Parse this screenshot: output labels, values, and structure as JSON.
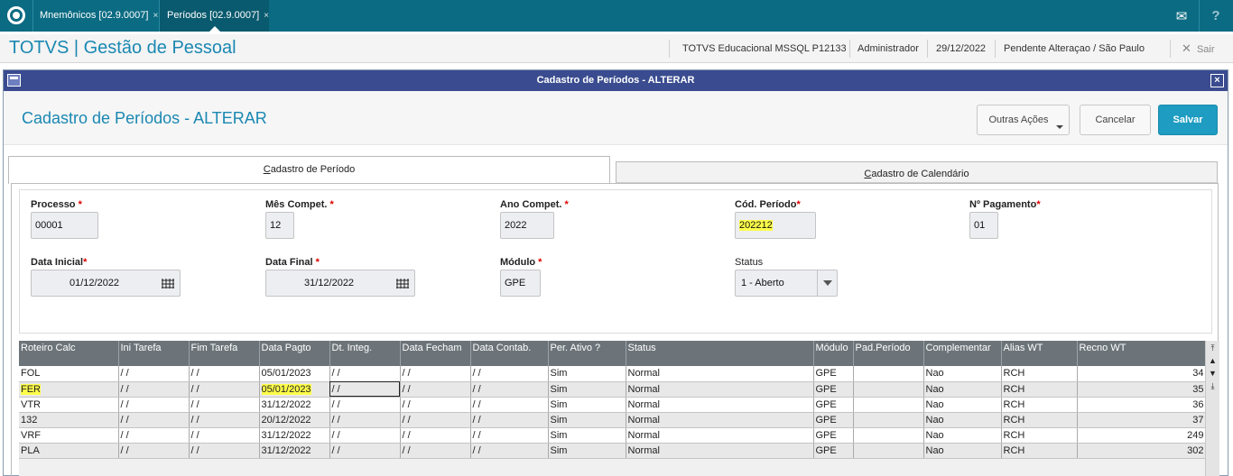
{
  "topbar": {
    "tabs": [
      {
        "label": "Mnemônicos [02.9.0007]"
      },
      {
        "label": "Períodos [02.9.0007]"
      }
    ],
    "close_glyph": "×",
    "mail_icon": "✉",
    "help_icon": "?"
  },
  "header": {
    "title": "TOTVS | Gestão de Pessoal",
    "environment": "TOTVS Educacional MSSQL P12133",
    "user": "Administrador",
    "date": "29/12/2022",
    "branch": "Pendente Alteraçao / São Paulo",
    "exit_label": "Sair",
    "exit_icon": "✕"
  },
  "dialog": {
    "window_title": "Cadastro de Períodos - ALTERAR",
    "close_glyph": "×",
    "form_title": "Cadastro de Períodos - ALTERAR",
    "buttons": {
      "other_actions": "Outras Ações",
      "cancel": "Cancelar",
      "save": "Salvar"
    },
    "tabs": [
      {
        "first": "C",
        "rest": "adastro de Período"
      },
      {
        "first": "C",
        "rest": "adastro de Calendário"
      }
    ]
  },
  "fields": {
    "processo": {
      "label": "Processo",
      "value": "00001"
    },
    "mes_compet": {
      "label": "Mês Compet.",
      "value": "12"
    },
    "ano_compet": {
      "label": "Ano Compet.",
      "value": "2022"
    },
    "cod_periodo": {
      "label": "Cód. Período",
      "value": "202212"
    },
    "n_pagamento": {
      "label": "Nº Pagamento",
      "value": "01"
    },
    "data_inicial": {
      "label": "Data Inicial",
      "value": "01/12/2022"
    },
    "data_final": {
      "label": "Data Final",
      "value": "31/12/2022"
    },
    "modulo": {
      "label": "Módulo",
      "value": "GPE"
    },
    "status": {
      "label": "Status",
      "value": "1 - Aberto"
    },
    "required_mark": "*"
  },
  "grid": {
    "columns": [
      "Roteiro Calc",
      "Ini Tarefa",
      "Fim Tarefa",
      "Data Pagto",
      "Dt. Integ.",
      "Data Fecham",
      "Data Contab.",
      "Per. Ativo ?",
      "Status",
      "Módulo",
      "Pad.Período",
      "Complementar",
      "Alias WT",
      "Recno WT"
    ],
    "rows": [
      [
        "FOL",
        " / /",
        " / /",
        "05/01/2023",
        " / /",
        " / /",
        " / /",
        "Sim",
        "Normal",
        "GPE",
        "",
        "Nao",
        "RCH",
        "34"
      ],
      [
        "FER",
        " / /",
        " / /",
        "05/01/2023",
        " / /",
        " / /",
        " / /",
        "Sim",
        "Normal",
        "GPE",
        "",
        "Nao",
        "RCH",
        "35"
      ],
      [
        "VTR",
        " / /",
        " / /",
        "31/12/2022",
        " / /",
        " / /",
        " / /",
        "Sim",
        "Normal",
        "GPE",
        "",
        "Nao",
        "RCH",
        "36"
      ],
      [
        "132",
        " / /",
        " / /",
        "20/12/2022",
        " / /",
        " / /",
        " / /",
        "Sim",
        "Normal",
        "GPE",
        "",
        "Nao",
        "RCH",
        "37"
      ],
      [
        "VRF",
        " / /",
        " / /",
        "31/12/2022",
        " / /",
        " / /",
        " / /",
        "Sim",
        "Normal",
        "GPE",
        "",
        "Nao",
        "RCH",
        "249"
      ],
      [
        "PLA",
        " / /",
        " / /",
        "31/12/2022",
        " / /",
        " / /",
        " / /",
        "Sim",
        "Normal",
        "GPE",
        "",
        "Nao",
        "RCH",
        "302"
      ]
    ],
    "highlighted_row": 1,
    "focused_cell": [
      1,
      4
    ],
    "highlight_color": "#ffff4a"
  },
  "scroll": {
    "top": "⤒",
    "up": "▲",
    "down": "▼",
    "bottom": "⤓"
  }
}
